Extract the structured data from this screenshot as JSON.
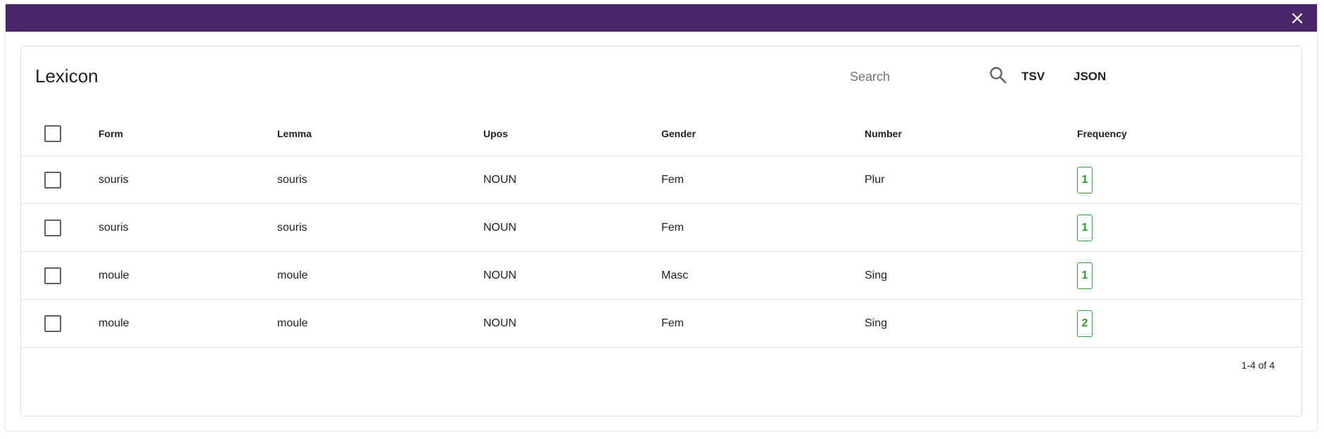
{
  "dialog": {
    "bar_color": "#4a266a",
    "close_icon": "close-icon"
  },
  "card": {
    "title": "Lexicon",
    "search": {
      "placeholder": "Search",
      "value": "",
      "icon": "search-icon"
    },
    "export": {
      "tsv_label": "TSV",
      "json_label": "JSON"
    }
  },
  "table": {
    "headers": {
      "form": "Form",
      "lemma": "Lemma",
      "upos": "Upos",
      "gender": "Gender",
      "number": "Number",
      "frequency": "Frequency"
    },
    "rows": [
      {
        "form": "souris",
        "lemma": "souris",
        "upos": "NOUN",
        "gender": "Fem",
        "number": "Plur",
        "frequency": "1"
      },
      {
        "form": "souris",
        "lemma": "souris",
        "upos": "NOUN",
        "gender": "Fem",
        "number": "",
        "frequency": "1"
      },
      {
        "form": "moule",
        "lemma": "moule",
        "upos": "NOUN",
        "gender": "Masc",
        "number": "Sing",
        "frequency": "1"
      },
      {
        "form": "moule",
        "lemma": "moule",
        "upos": "NOUN",
        "gender": "Fem",
        "number": "Sing",
        "frequency": "2"
      }
    ],
    "pagination": "1-4 of 4"
  },
  "colors": {
    "accent": "#4a266a",
    "frequency_chip": "#2e9e2e"
  }
}
